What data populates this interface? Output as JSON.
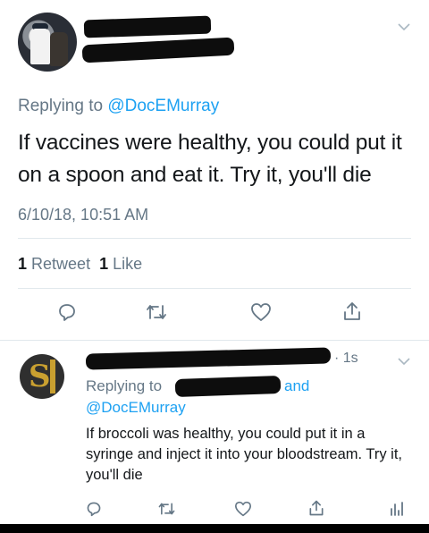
{
  "main_tweet": {
    "replying_prefix": "Replying to ",
    "replying_handle": "@DocEMurray",
    "text": "If vaccines were healthy, you could put it on a spoon and eat it. Try it, you'll die",
    "timestamp": "6/10/18, 10:51 AM",
    "retweets_count": "1",
    "retweets_label": "Retweet",
    "likes_count": "1",
    "likes_label": "Like"
  },
  "reply_tweet": {
    "time": "· 1s",
    "replying_prefix": "Replying to",
    "replying_and": "and",
    "replying_handle": "@DocEMurray",
    "text": "If broccoli was healthy, you could put it in a syringe and inject it into your bloodstream. Try it, you'll die"
  },
  "icons": {
    "reply": "reply-icon",
    "retweet": "retweet-icon",
    "like": "heart-icon",
    "share": "share-icon",
    "analytics": "analytics-icon",
    "chevron": "chevron-down-icon"
  },
  "colors": {
    "link": "#1da1f2",
    "secondary": "#657786",
    "text": "#14171a",
    "icon": "#657786"
  }
}
